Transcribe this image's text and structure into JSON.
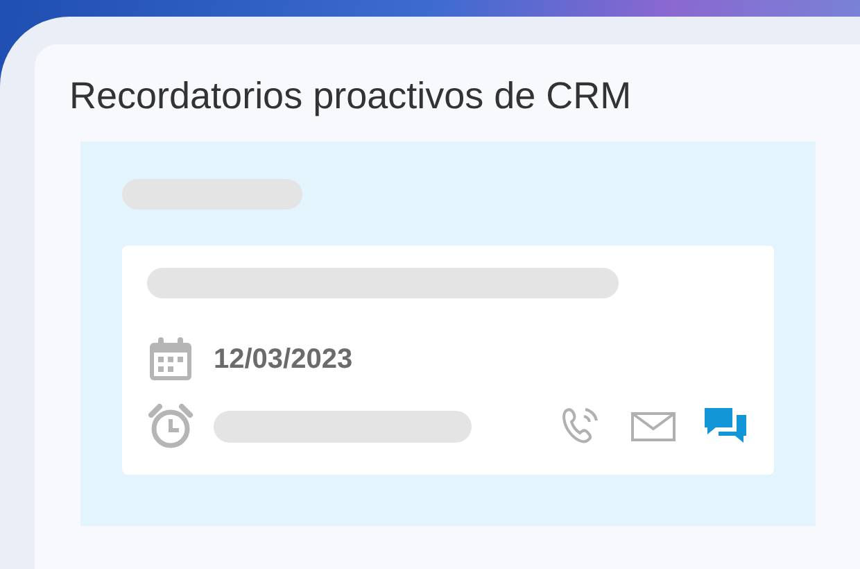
{
  "title": "Recordatorios proactivos de CRM",
  "reminder": {
    "date": "12/03/2023"
  },
  "actions": [
    {
      "kind": "phone",
      "selected": false
    },
    {
      "kind": "mail",
      "selected": false
    },
    {
      "kind": "chat",
      "selected": true
    }
  ]
}
